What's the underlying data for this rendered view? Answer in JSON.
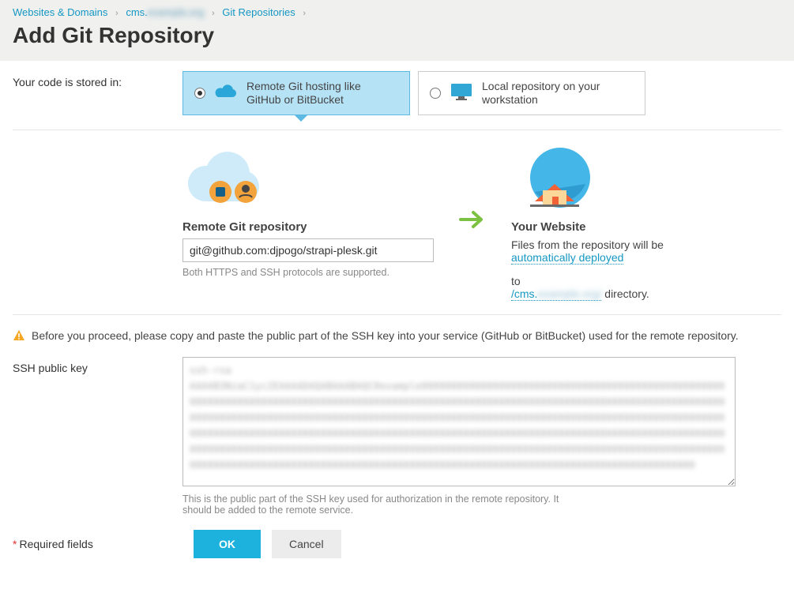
{
  "breadcrumb": {
    "a": "Websites & Domains",
    "b": "cms.",
    "b_hidden": "example.org",
    "c": "Git Repositories"
  },
  "title": "Add Git Repository",
  "storage": {
    "label": "Your code is stored in:",
    "option_remote": "Remote Git hosting like GitHub or BitBucket",
    "option_local": "Local repository on your workstation"
  },
  "remote": {
    "title": "Remote Git repository",
    "value": "git@github.com:djpogo/strapi-plesk.git",
    "hint": "Both HTTPS and SSH protocols are supported."
  },
  "website": {
    "title": "Your Website",
    "line1": "Files from the repository will be",
    "link_deploy": "automatically deployed",
    "to": "to",
    "dir_prefix": "/cms.",
    "dir_hidden": "example.org/",
    "dir_suffix": " directory."
  },
  "ssh_notice": "Before you proceed, please copy and paste the public part of the SSH key into your service (GitHub or BitBucket) used for the remote repository.",
  "ssh": {
    "label": "SSH public key",
    "value": "ssh-rsa AAAAB3NzaC1yc2EAAAADAQABAAABAQC0example0000000000000000000000000000000000000000000000000000000000000000000000000000000000000000000000000000000000000000000000000000000000000000000000000000000000000000000000000000000000000000000000000000000000000000000000000000000000000000000000000000000000000000000000000000000000000000000000000000000000000000000000000000000000000000000000000000000000000000000000000000000000000000000000000000000000000000000000000000000000000000000000000000000000000000000000000000000000000000000000000000000000000000",
    "hint": "This is the public part of the SSH key used for authorization in the remote repository. It should be added to the remote service."
  },
  "footer": {
    "required": "Required fields",
    "ok": "OK",
    "cancel": "Cancel"
  }
}
